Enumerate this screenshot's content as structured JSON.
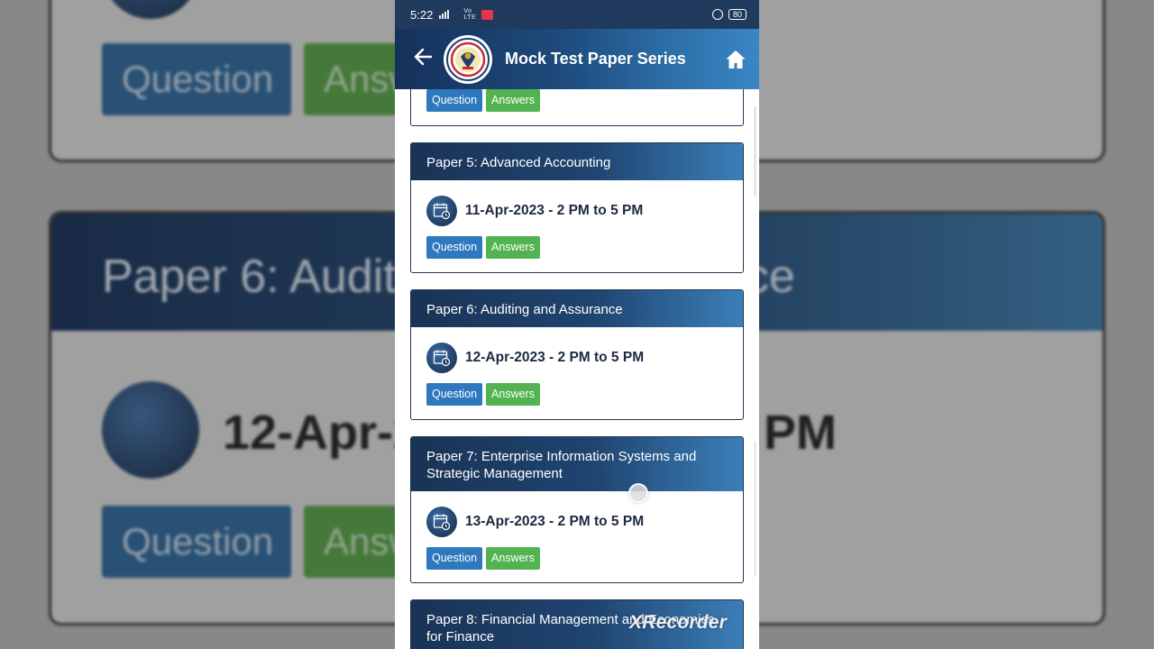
{
  "status_bar": {
    "time": "5:22",
    "signal_text": "Vo LTE",
    "battery": "80"
  },
  "app_bar": {
    "title": "Mock Test Paper Series",
    "back_icon": "arrow-left-icon",
    "home_icon": "home-icon"
  },
  "papers": [
    {
      "title": "",
      "date": "",
      "question_label": "Question",
      "answers_label": "Answers"
    },
    {
      "title": "Paper 5: Advanced Accounting",
      "date": "11-Apr-2023 - 2 PM to 5 PM",
      "question_label": "Question",
      "answers_label": "Answers"
    },
    {
      "title": "Paper 6: Auditing and Assurance",
      "date": "12-Apr-2023 - 2 PM to 5 PM",
      "question_label": "Question",
      "answers_label": "Answers"
    },
    {
      "title": "Paper 7: Enterprise Information Systems and Strategic Management",
      "date": "13-Apr-2023 - 2 PM to 5 PM",
      "question_label": "Question",
      "answers_label": "Answers"
    },
    {
      "title": "Paper 8: Financial Management and Economics for Finance",
      "date": "",
      "question_label": "",
      "answers_label": ""
    }
  ],
  "background_zoom": {
    "heading": "Paper 6: Audit",
    "heading_tail": "ce",
    "date_left": "12-Apr-2",
    "date_right": "PM",
    "question_label": "Question",
    "answers_label": "Answ"
  },
  "watermark": "XRecorder",
  "colors": {
    "app_bar": "#1d4a7b",
    "card_header": "#1f4470",
    "question_button": "#2e78bd",
    "answers_button": "#53b352"
  }
}
